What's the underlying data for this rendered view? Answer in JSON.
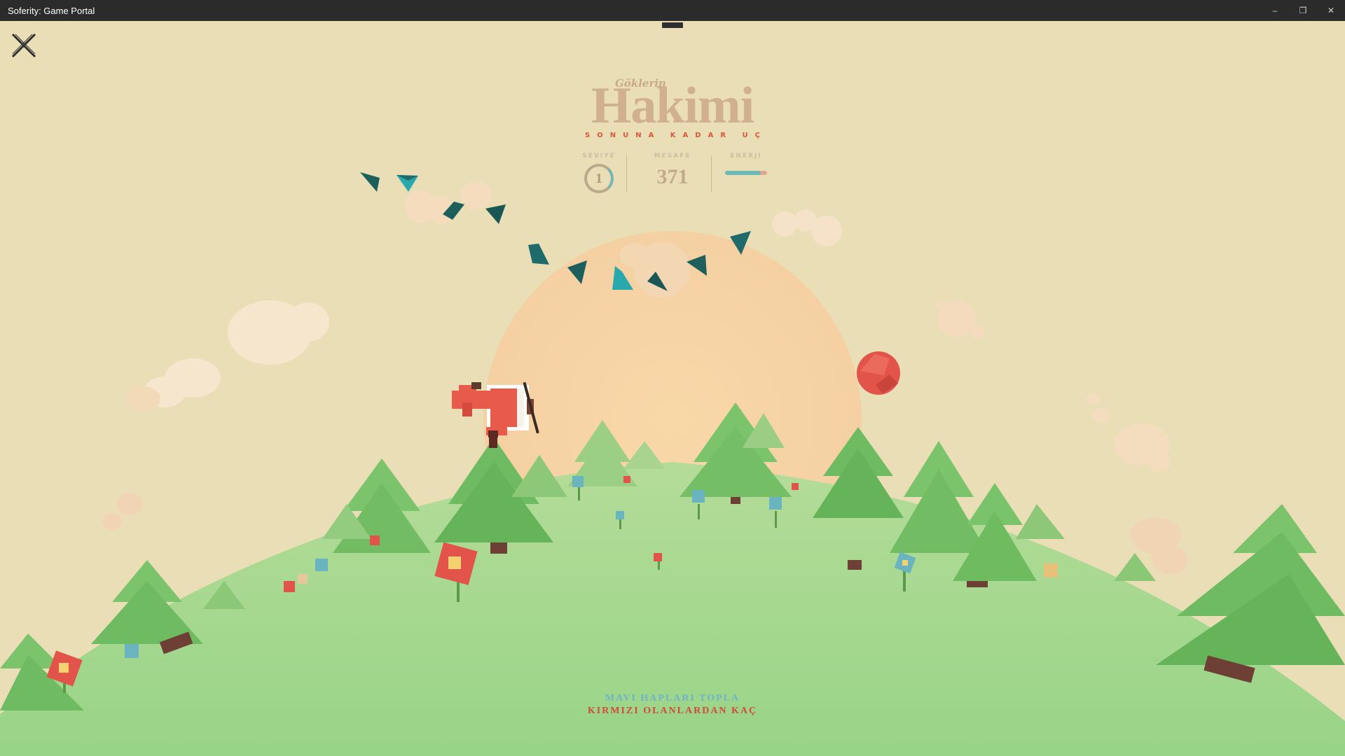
{
  "window": {
    "title": "Soferity: Game Portal",
    "controls": {
      "minimize": "–",
      "maximize": "❐",
      "close": "✕"
    }
  },
  "game": {
    "logo": {
      "small": "Göklerin",
      "title": "Hakimi",
      "subtitle": "SONUNA KADAR UÇ"
    },
    "stats": {
      "level_label": "SEVIYE",
      "level_value": "1",
      "distance_label": "MESAFE",
      "distance_value": "371",
      "energy_label": "ENERJI",
      "energy_fraction": 0.85
    },
    "instructions": {
      "line1": "MAVI HAPLARI TOPLA",
      "line2": "KIRMIZI OLANLARDAN KAÇ"
    },
    "colors": {
      "sky": "#e8ddb5",
      "sun": "#f6d3a4",
      "ground": "#9fd689",
      "tree": "#7cc46c",
      "plane": "#e85a4a",
      "enemy": "#e0504a",
      "pill": "#1f6a6a"
    },
    "icons": {
      "close": "close-x-icon"
    }
  }
}
